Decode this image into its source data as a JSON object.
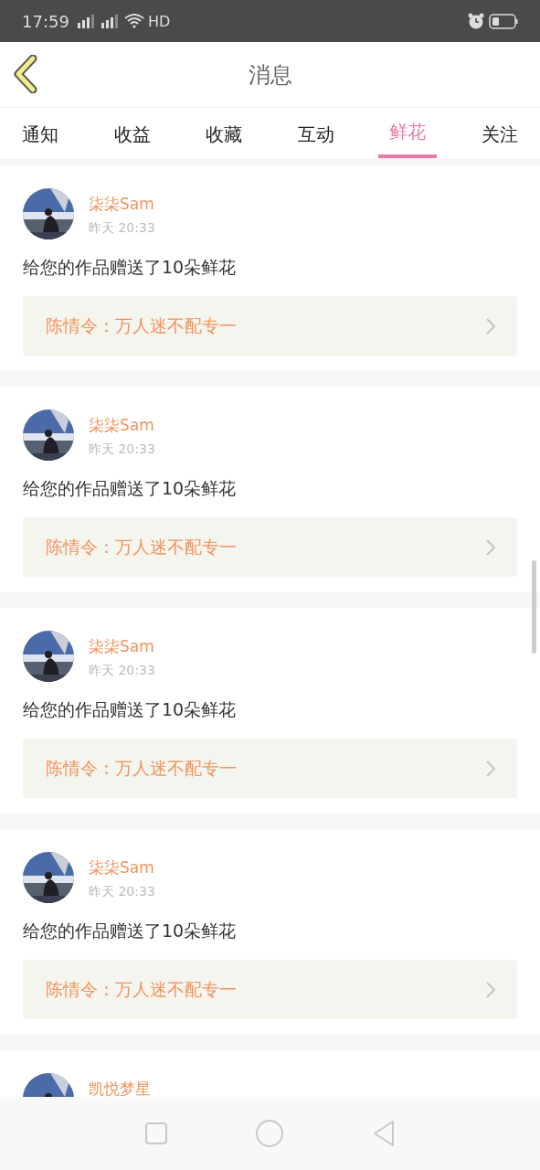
{
  "status_bar": {
    "time": "17:59",
    "hd": "HD"
  },
  "header": {
    "title": "消息"
  },
  "tabs": [
    {
      "label": "通知",
      "selected": false
    },
    {
      "label": "收益",
      "selected": false
    },
    {
      "label": "收藏",
      "selected": false
    },
    {
      "label": "互动",
      "selected": false
    },
    {
      "label": "鲜花",
      "selected": true
    },
    {
      "label": "关注",
      "selected": false
    }
  ],
  "messages": [
    {
      "user": "柒柒Sam",
      "time": "昨天 20:33",
      "text": "给您的作品赠送了10朵鲜花",
      "work": "陈情令：万人迷不配专一"
    },
    {
      "user": "柒柒Sam",
      "time": "昨天 20:33",
      "text": "给您的作品赠送了10朵鲜花",
      "work": "陈情令：万人迷不配专一"
    },
    {
      "user": "柒柒Sam",
      "time": "昨天 20:33",
      "text": "给您的作品赠送了10朵鲜花",
      "work": "陈情令：万人迷不配专一"
    },
    {
      "user": "柒柒Sam",
      "time": "昨天 20:33",
      "text": "给您的作品赠送了10朵鲜花",
      "work": "陈情令：万人迷不配专一"
    },
    {
      "user": "凯悦梦星"
    }
  ]
}
